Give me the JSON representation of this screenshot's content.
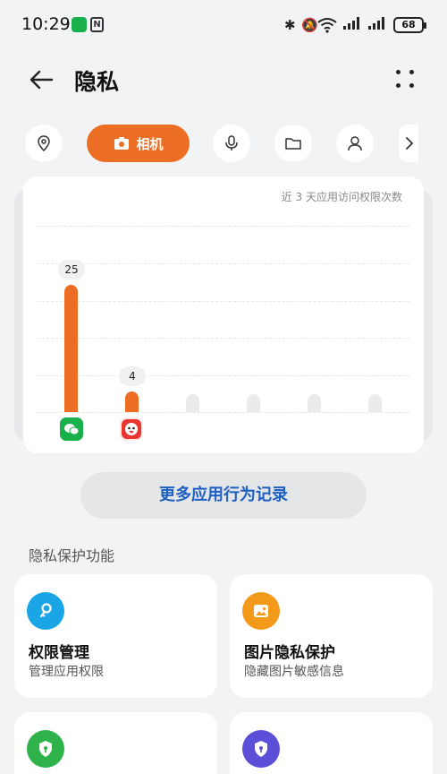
{
  "status_bar": {
    "time": "10:29",
    "battery": "68",
    "wifi_superscript": "6"
  },
  "header": {
    "title": "隐私"
  },
  "filters": {
    "active_label": "相机",
    "items": [
      "location-icon",
      "camera-icon",
      "microphone-icon",
      "folder-icon",
      "contacts-icon",
      "chevron-right-icon"
    ]
  },
  "chart": {
    "note": "近 3 天应用访问权限次数"
  },
  "chart_data": {
    "type": "bar",
    "categories": [
      "微信",
      "App 2",
      "",
      "",
      "",
      ""
    ],
    "values": [
      25,
      4,
      0,
      0,
      0,
      0
    ],
    "title": "近 3 天应用访问权限次数",
    "xlabel": "",
    "ylabel": "",
    "ylim": [
      0,
      30
    ],
    "colors": {
      "active": "#ec6e24",
      "inactive": "#ebebeb"
    }
  },
  "more_button": "更多应用行为记录",
  "section": {
    "title": "隐私保护功能"
  },
  "features": [
    {
      "title": "权限管理",
      "subtitle": "管理应用权限",
      "icon": "key-icon",
      "color": "#1aa6e6"
    },
    {
      "title": "图片隐私保护",
      "subtitle": "隐藏图片敏感信息",
      "icon": "image-icon",
      "color": "#f39a1b"
    },
    {
      "title": "",
      "subtitle": "",
      "icon": "shield-lock-icon",
      "color": "#2fb24a"
    },
    {
      "title": "",
      "subtitle": "",
      "icon": "shield-lock-icon",
      "color": "#5a4fd6"
    }
  ]
}
